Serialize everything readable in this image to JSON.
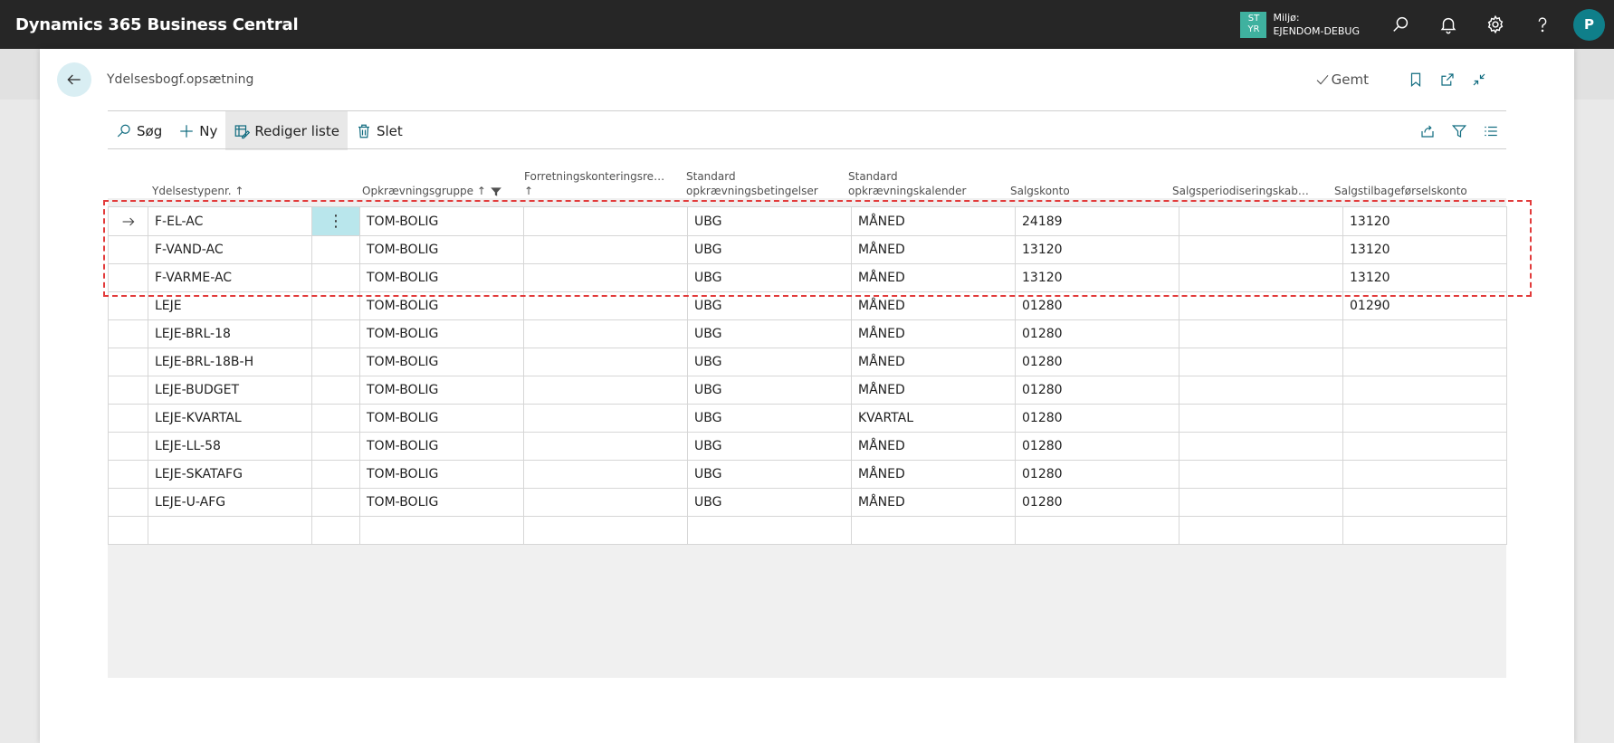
{
  "app": {
    "title": "Dynamics 365 Business Central"
  },
  "environment": {
    "badge_line1": "ST",
    "badge_line2": "YR",
    "label": "Miljø:",
    "name": "EJENDOM-DEBUG"
  },
  "user": {
    "initial": "P"
  },
  "page": {
    "title": "Ydelsesbogf.opsætning",
    "saved_label": "Gemt"
  },
  "actions": {
    "search": "Søg",
    "new": "Ny",
    "edit_list": "Rediger liste",
    "delete": "Slet"
  },
  "columns": [
    {
      "label": "Ydelsestypenr. ↑"
    },
    {
      "label": "Opkrævningsgruppe ↑"
    },
    {
      "label": "Forretningskonteringsre…",
      "line2": "↑"
    },
    {
      "label": "Standard",
      "line2": "opkrævningsbetingelser"
    },
    {
      "label": "Standard",
      "line2": "opkrævningskalender"
    },
    {
      "label": "Salgskonto"
    },
    {
      "label": "Salgsperiodiseringskab…"
    },
    {
      "label": "Salgstilbageførselskonto"
    }
  ],
  "rows": [
    {
      "type": "F-EL-AC",
      "group": "TOM-BOLIG",
      "bus": "",
      "terms": "UBG",
      "calendar": "MÅNED",
      "sales": "24189",
      "deferral": "",
      "reversal": "13120"
    },
    {
      "type": "F-VAND-AC",
      "group": "TOM-BOLIG",
      "bus": "",
      "terms": "UBG",
      "calendar": "MÅNED",
      "sales": "13120",
      "deferral": "",
      "reversal": "13120"
    },
    {
      "type": "F-VARME-AC",
      "group": "TOM-BOLIG",
      "bus": "",
      "terms": "UBG",
      "calendar": "MÅNED",
      "sales": "13120",
      "deferral": "",
      "reversal": "13120"
    },
    {
      "type": "LEJE",
      "group": "TOM-BOLIG",
      "bus": "",
      "terms": "UBG",
      "calendar": "MÅNED",
      "sales": "01280",
      "deferral": "",
      "reversal": "01290"
    },
    {
      "type": "LEJE-BRL-18",
      "group": "TOM-BOLIG",
      "bus": "",
      "terms": "UBG",
      "calendar": "MÅNED",
      "sales": "01280",
      "deferral": "",
      "reversal": ""
    },
    {
      "type": "LEJE-BRL-18B-H",
      "group": "TOM-BOLIG",
      "bus": "",
      "terms": "UBG",
      "calendar": "MÅNED",
      "sales": "01280",
      "deferral": "",
      "reversal": ""
    },
    {
      "type": "LEJE-BUDGET",
      "group": "TOM-BOLIG",
      "bus": "",
      "terms": "UBG",
      "calendar": "MÅNED",
      "sales": "01280",
      "deferral": "",
      "reversal": ""
    },
    {
      "type": "LEJE-KVARTAL",
      "group": "TOM-BOLIG",
      "bus": "",
      "terms": "UBG",
      "calendar": "KVARTAL",
      "sales": "01280",
      "deferral": "",
      "reversal": ""
    },
    {
      "type": "LEJE-LL-58",
      "group": "TOM-BOLIG",
      "bus": "",
      "terms": "UBG",
      "calendar": "MÅNED",
      "sales": "01280",
      "deferral": "",
      "reversal": ""
    },
    {
      "type": "LEJE-SKATAFG",
      "group": "TOM-BOLIG",
      "bus": "",
      "terms": "UBG",
      "calendar": "MÅNED",
      "sales": "01280",
      "deferral": "",
      "reversal": ""
    },
    {
      "type": "LEJE-U-AFG",
      "group": "TOM-BOLIG",
      "bus": "",
      "terms": "UBG",
      "calendar": "MÅNED",
      "sales": "01280",
      "deferral": "",
      "reversal": ""
    },
    {
      "type": "",
      "group": "",
      "bus": "",
      "terms": "",
      "calendar": "",
      "sales": "",
      "deferral": "",
      "reversal": ""
    }
  ]
}
